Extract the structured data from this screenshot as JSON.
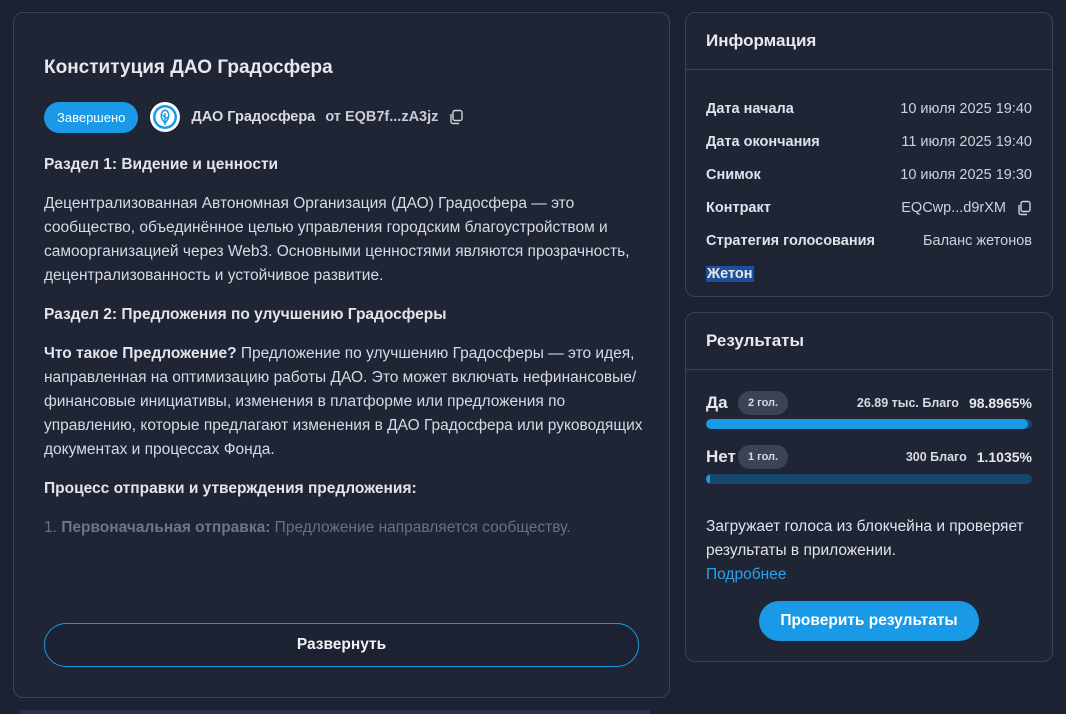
{
  "proposal": {
    "title": "Конституция ДАО Градосфера",
    "status": "Завершено",
    "dao_name": "ДАО Градосфера",
    "author": "от EQB7f...zA3jz",
    "section1_heading": "Раздел 1: Видение и ценности",
    "section1_text": "Децентрализованная Автономная Организация (ДАО) Градосфера — это сообщество, объединённое целью управления городским благоустройством и самоорганизацией через Web3. Основными ценностями являются прозрачность, децентрализованность и устойчивое развитие.",
    "section2_heading": "Раздел 2: Предложения по улучшению Градосферы",
    "what_is_label": "Что такое Предложение?",
    "what_is_text": " Предложение по улучшению Градосферы — это идея, направленная на оптимизацию работы ДАО. Это может включать нефинансовые/финансовые инициативы, изменения в платформе или предложения по управлению, которые предлагают изменения в ДАО Градосфера или руководящих документах и процессах Фонда.",
    "process_heading": "Процесс отправки и утверждения предложения:",
    "step1_num": "1. ",
    "step1_label": "Первоначальная отправка:",
    "step1_text": " Предложение направляется сообществу.",
    "expand_label": "Развернуть"
  },
  "info": {
    "title": "Информация",
    "rows": [
      {
        "key": "Дата начала",
        "value": "10 июля 2025 19:40"
      },
      {
        "key": "Дата окончания",
        "value": "11 июля 2025 19:40"
      },
      {
        "key": "Снимок",
        "value": "10 июля 2025 19:30"
      },
      {
        "key": "Контракт",
        "value": "EQCwp...d9rXM"
      },
      {
        "key": "Стратегия голосования",
        "value": "Баланс жетонов"
      }
    ],
    "token_label": "Жетон"
  },
  "results": {
    "title": "Результаты",
    "options": [
      {
        "label": "Да",
        "votes": "2 гол.",
        "amount": "26.89 тыс. Благо",
        "percent": "98.8965%",
        "fraction": 0.988965
      },
      {
        "label": "Нет",
        "votes": "1 гол.",
        "amount": "300 Благо",
        "percent": "1.1035%",
        "fraction": 0.011035
      }
    ],
    "note": "Загружает голоса из блокчейна и проверяет результаты в приложении.",
    "more_link": "Подробнее",
    "check_button": "Проверить результаты"
  },
  "colors": {
    "accent": "#1a9ae6",
    "bar_track": "#15476f",
    "card_bg": "#1f2535"
  },
  "icons": [
    "dao-logo-icon",
    "copy-icon"
  ]
}
